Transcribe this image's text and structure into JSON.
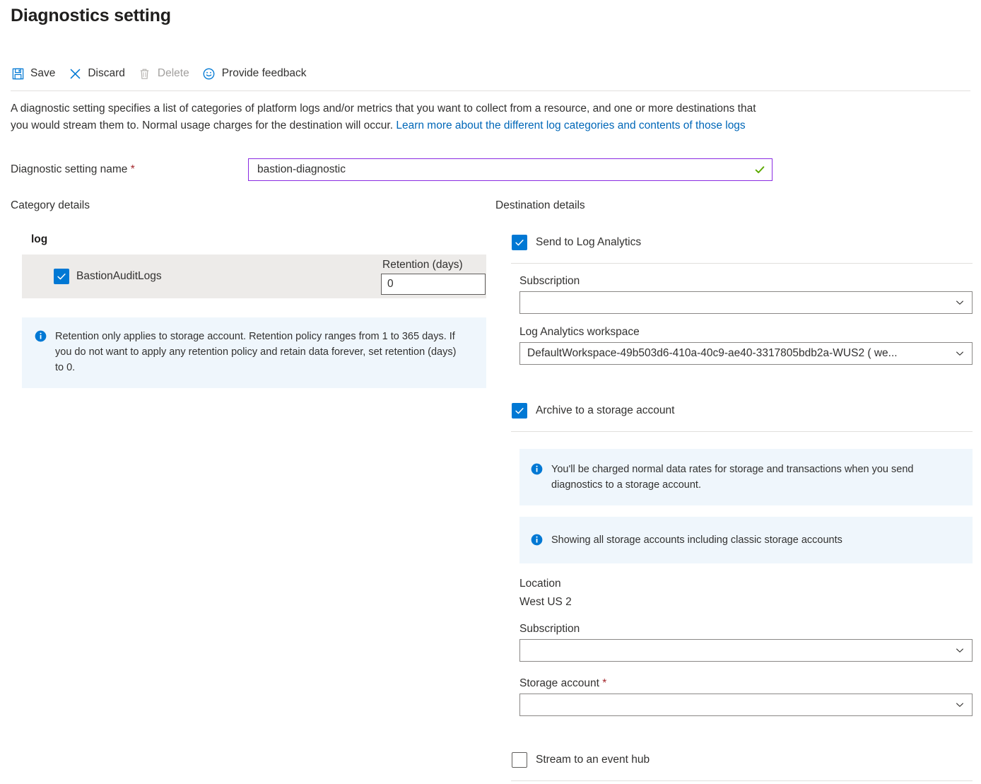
{
  "page": {
    "title": "Diagnostics setting"
  },
  "toolbar": {
    "items": [
      {
        "label": "Save",
        "icon": "save-icon",
        "disabled": false
      },
      {
        "label": "Discard",
        "icon": "discard-icon",
        "disabled": false
      },
      {
        "label": "Delete",
        "icon": "delete-icon",
        "disabled": true
      },
      {
        "label": "Provide feedback",
        "icon": "feedback-icon",
        "disabled": false
      }
    ]
  },
  "description": {
    "text_before": "A diagnostic setting specifies a list of categories of platform logs and/or metrics that you want to collect from a resource, and one or more destinations that you would stream them to. Normal usage charges for the destination will occur. ",
    "link_text": "Learn more about the different log categories and contents of those logs"
  },
  "name_field": {
    "label": "Diagnostic setting name",
    "required_marker": "*",
    "value": "bastion-diagnostic",
    "placeholder": "",
    "valid": true
  },
  "category_details": {
    "heading": "Category details",
    "group_title": "log",
    "retention_header": "Retention (days)",
    "rows": [
      {
        "label": "BastionAuditLogs",
        "checked": true,
        "retention": "0"
      }
    ],
    "info": "Retention only applies to storage account. Retention policy ranges from 1 to 365 days. If you do not want to apply any retention policy and retain data forever, set retention (days) to 0."
  },
  "destination_details": {
    "heading": "Destination details",
    "log_analytics": {
      "checkbox_label": "Send to Log Analytics",
      "checked": true,
      "subscription_label": "Subscription",
      "subscription_value": "",
      "workspace_label": "Log Analytics workspace",
      "workspace_value": "DefaultWorkspace-49b503d6-410a-40c9-ae40-3317805bdb2a-WUS2 ( we..."
    },
    "storage": {
      "checkbox_label": "Archive to a storage account",
      "checked": true,
      "info_charges": "You'll be charged normal data rates for storage and transactions when you send diagnostics to a storage account.",
      "info_showing": "Showing all storage accounts including classic storage accounts",
      "location_label": "Location",
      "location_value": "West US 2",
      "subscription_label": "Subscription",
      "subscription_value": "",
      "storage_account_label": "Storage account",
      "storage_account_required": "*",
      "storage_account_value": ""
    },
    "event_hub": {
      "checkbox_label": "Stream to an event hub",
      "checked": false
    }
  },
  "colors": {
    "accent_blue": "#0078d4",
    "link_blue": "#0067b8",
    "required_red": "#a4262c",
    "valid_green": "#5ca900",
    "input_focus_purple": "#8a2be2",
    "info_bg": "#eff6fc",
    "row_bg": "#edebe9",
    "text": "#323130",
    "disabled_text": "#a19f9d"
  }
}
